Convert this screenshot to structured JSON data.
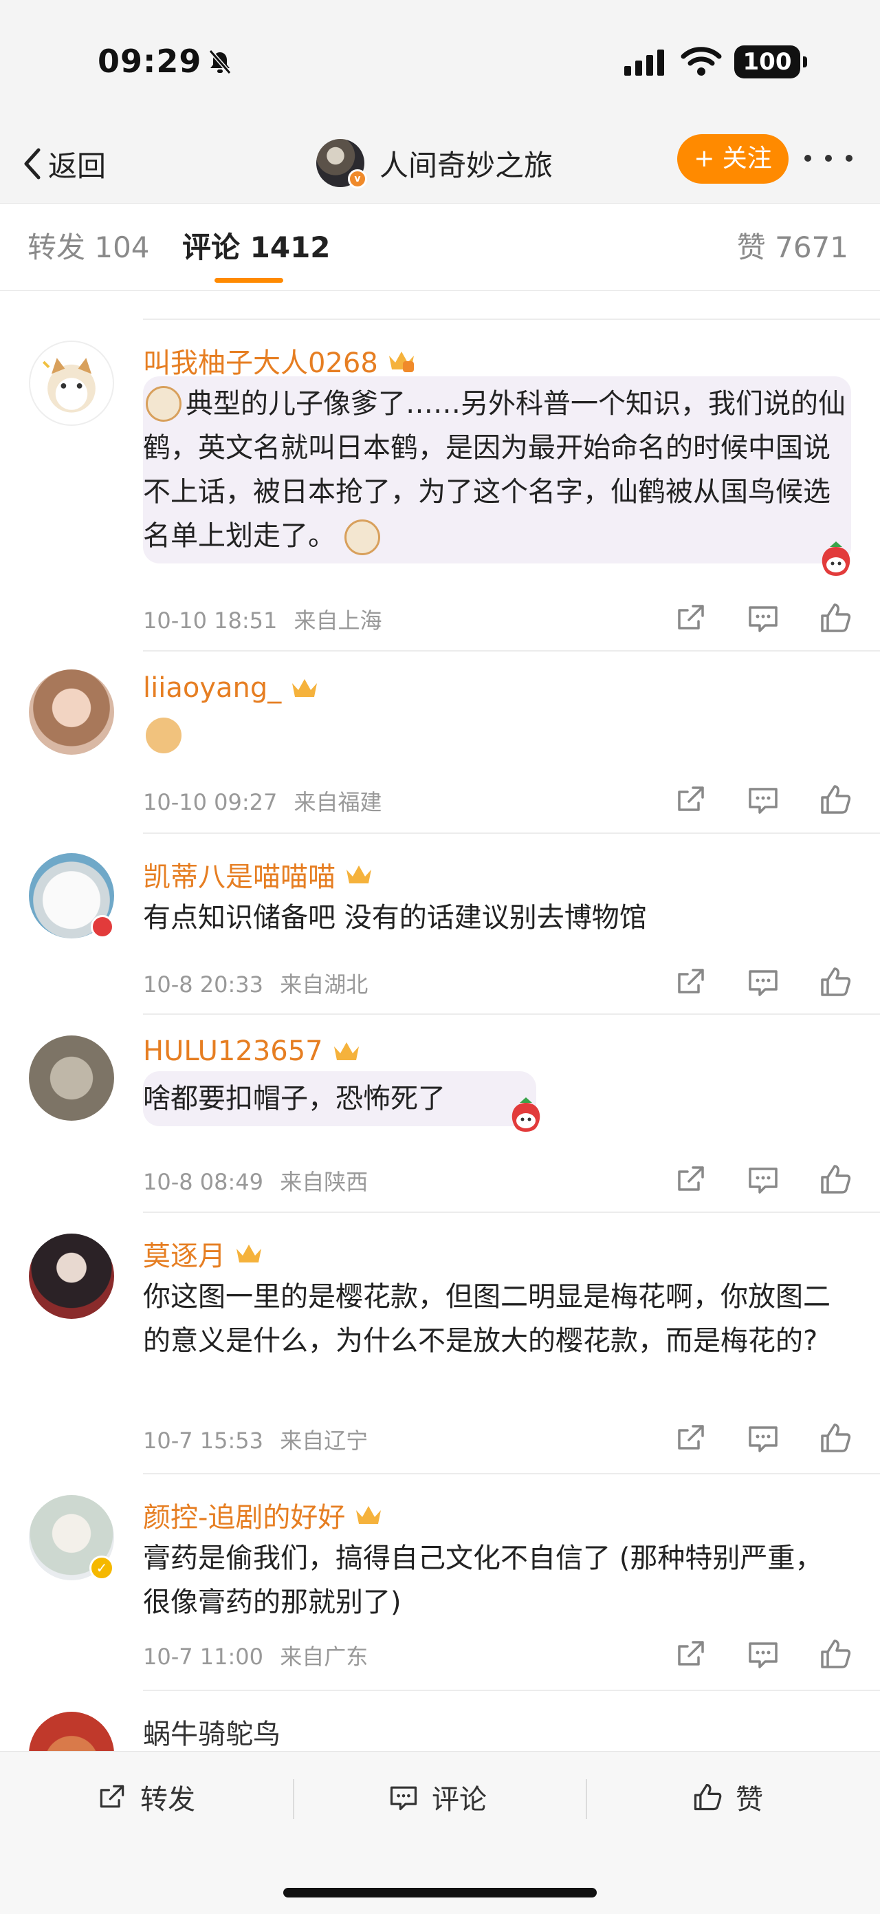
{
  "status_bar": {
    "time": "09:29",
    "battery": "100"
  },
  "nav": {
    "back_label": "返回",
    "title": "人间奇妙之旅",
    "follow_label": "+ 关注"
  },
  "tabs": {
    "repost": "转发 104",
    "comment": "评论 1412",
    "like": "赞 7671"
  },
  "comments": [
    {
      "username": "叫我柚子大人0268",
      "text_parts": [
        "典型的儿子像爹了……另外科普一个知识，我们说的仙鹤，英文名就叫日本鹤，是因为最开始命名的时候中国说不上话，被日本抢了，为了这个名字，仙鹤被从国鸟候选名单上划走了。"
      ],
      "time": "10-10 18:51",
      "location": "来自上海"
    },
    {
      "username": "liiaoyang_",
      "time": "10-10 09:27",
      "location": "来自福建"
    },
    {
      "username": "凯蒂八是喵喵喵",
      "text": "有点知识储备吧 没有的话建议别去博物馆",
      "time": "10-8 20:33",
      "location": "来自湖北"
    },
    {
      "username": "HULU123657",
      "text": "啥都要扣帽子，恐怖死了",
      "time": "10-8 08:49",
      "location": "来自陕西"
    },
    {
      "username": "莫逐月",
      "text": "你这图一里的是樱花款，但图二明显是梅花啊，你放图二的意义是什么，为什么不是放大的樱花款，而是梅花的?",
      "time": "10-7 15:53",
      "location": "来自辽宁"
    },
    {
      "username": "颜控-追剧的好好",
      "text": "膏药是偷我们，搞得自己文化不自信了 (那种特别严重，很像膏药的那就别了)",
      "time": "10-7 11:00",
      "location": "来自广东"
    },
    {
      "username": "蜗牛骑鸵鸟"
    }
  ],
  "bottom_bar": {
    "repost": "转发",
    "comment": "评论",
    "like": "赞"
  },
  "colors": {
    "accent": "#ff8a00",
    "username": "#e67e22",
    "bubble": "#f3eff7",
    "meta": "#999999"
  },
  "icons": [
    "bell-slash-icon",
    "signal-icon",
    "wifi-icon",
    "battery-icon",
    "chevron-left-icon",
    "more-icon",
    "crown-badge-icon",
    "share-icon",
    "comment-icon",
    "like-icon",
    "cat-emoji-icon",
    "doge-emoji-icon",
    "strawberry-sticker-icon"
  ]
}
